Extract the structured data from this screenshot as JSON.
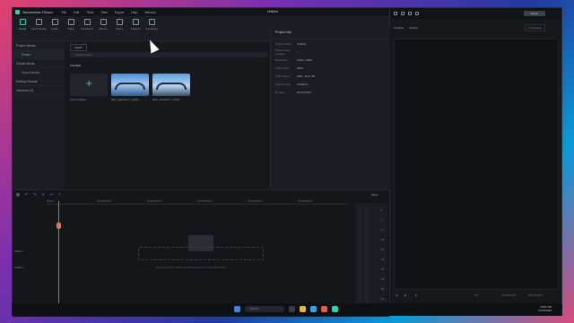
{
  "app": {
    "name": "Wondershare Filmora",
    "doc_title": "Untitled"
  },
  "menu": [
    "File",
    "Edit",
    "Tools",
    "View",
    "Export",
    "Help",
    "Window"
  ],
  "toolbar": [
    {
      "label": "Media",
      "icon": "media-icon",
      "active": true
    },
    {
      "label": "Stock Media",
      "icon": "stock-icon"
    },
    {
      "label": "Audio",
      "icon": "audio-icon"
    },
    {
      "label": "Titles",
      "icon": "titles-icon"
    },
    {
      "label": "Transitions",
      "icon": "transitions-icon"
    },
    {
      "label": "Effects",
      "icon": "effects-icon"
    },
    {
      "label": "Filters",
      "icon": "filters-icon"
    },
    {
      "label": "Stickers",
      "icon": "stickers-icon"
    },
    {
      "label": "Templates",
      "icon": "templates-icon"
    }
  ],
  "sidebar": {
    "items": [
      {
        "label": "Project Media"
      },
      {
        "label": "Folder",
        "active": true
      },
      {
        "label": "Global Media"
      },
      {
        "label": "Cloud Media"
      },
      {
        "label": "Editing Presets"
      },
      {
        "label": "Influence (0)"
      }
    ]
  },
  "media": {
    "import_label": "Import",
    "search_placeholder": "Search media",
    "folder_label": "FOLDER",
    "import_tile_label": "Import Media",
    "clips": [
      {
        "caption": "IMG_20240217_20231..."
      },
      {
        "caption": "IMG_20240217_20231..."
      }
    ]
  },
  "info": {
    "title": "Project Info",
    "rows": [
      {
        "k": "Project Name",
        "v": "Untitled"
      },
      {
        "k": "Project Files Location",
        "v": "/"
      },
      {
        "k": "Resolution",
        "v": "1920 x 1080"
      },
      {
        "k": "Frame Rate",
        "v": "25fps"
      },
      {
        "k": "Color Space",
        "v": "SDR - Rec.709"
      },
      {
        "k": "Sample Rate",
        "v": "44100Hz"
      },
      {
        "k": "Duration",
        "v": "00:00:00:00"
      }
    ]
  },
  "timeline": {
    "master_label": "Meter",
    "ruler": [
      "00:00",
      "00:00:05:00",
      "00:00:10:00",
      "00:00:15:00",
      "00:00:20:00",
      "00:00:25:00",
      "00:00:30:00"
    ],
    "tracks": [
      {
        "label": "Video 1"
      },
      {
        "label": "Audio 1"
      }
    ],
    "drop_hint": "Drag and drop media and effects here to create your video.",
    "meter_labels": [
      "0",
      "-6",
      "-12",
      "-18",
      "-24",
      "-30",
      "-36",
      "-42",
      "-48",
      "-54"
    ]
  },
  "player": {
    "tabs": [
      "Timeline",
      "Source"
    ],
    "export_label": "Export",
    "fit_label": "Full Quality",
    "time_current": "00:00:00:00",
    "time_total": "00:00:00:00",
    "ratio": "1/2"
  },
  "taskbar": {
    "search_placeholder": "Search",
    "time": "10:01 PM",
    "date": "17/04/2024"
  }
}
